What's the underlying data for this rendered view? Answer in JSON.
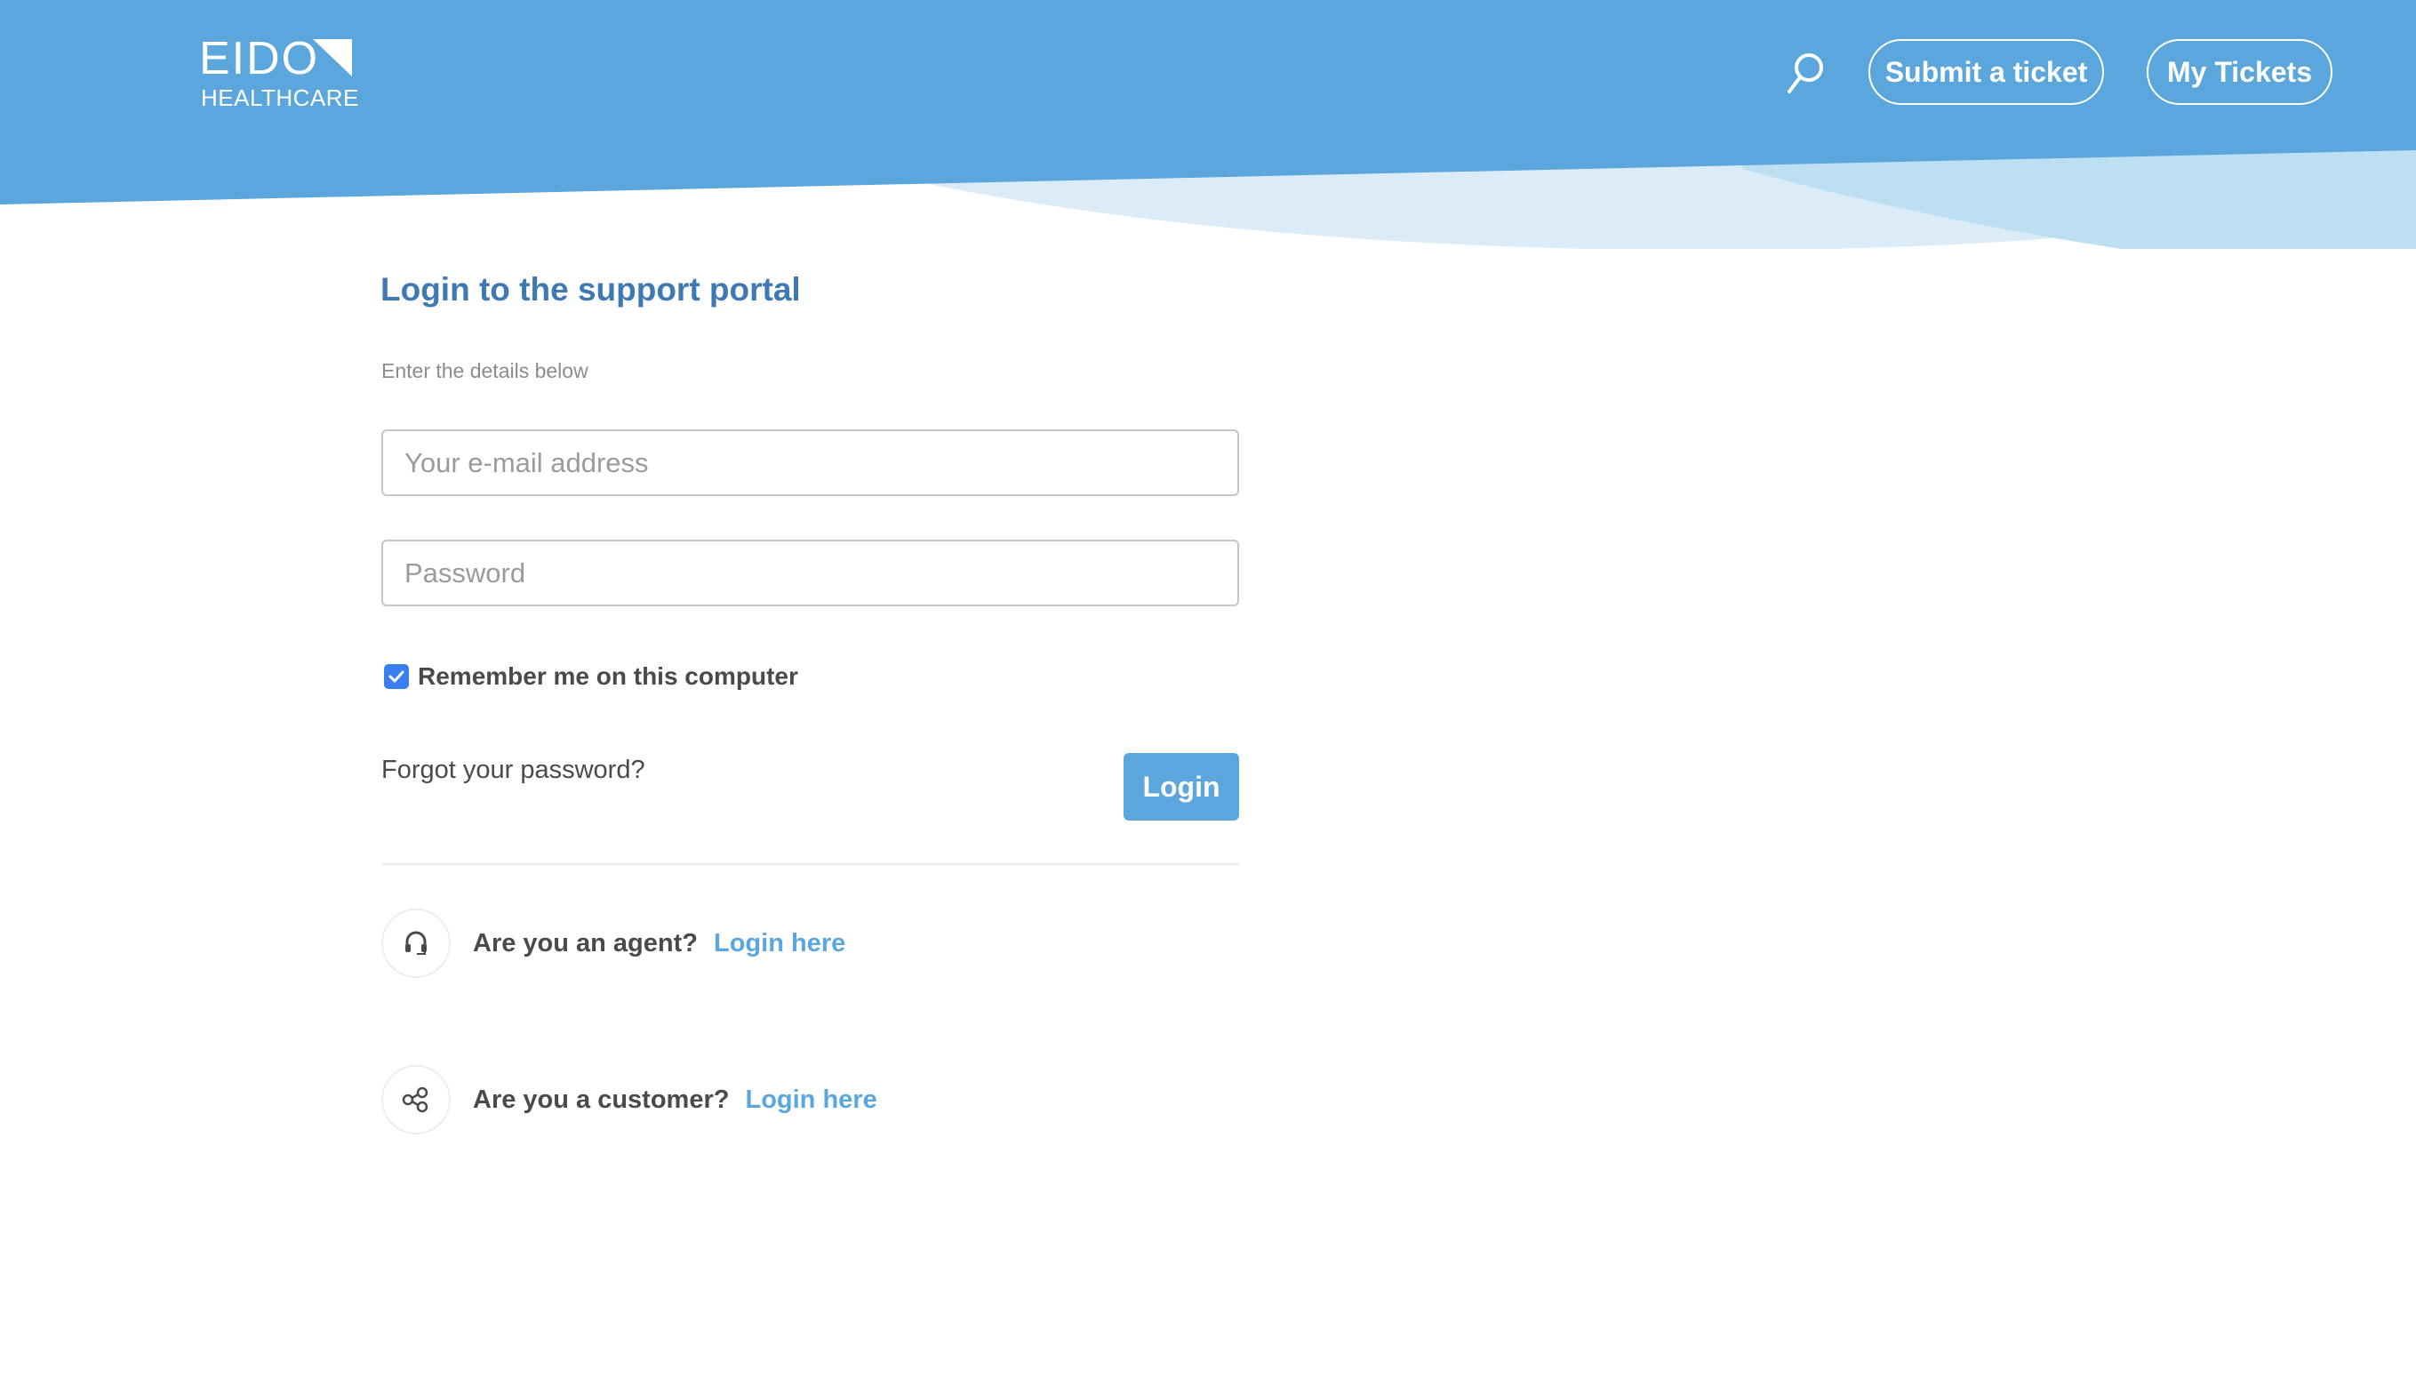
{
  "brand": {
    "logo_word": "EIDO",
    "logo_sub": "HEALTHCARE",
    "primary_color": "#5ba7dd",
    "heading_color": "#3f79b3",
    "checkbox_color": "#3a7ff0"
  },
  "header": {
    "search_icon": "search-icon",
    "submit_ticket_label": "Submit a ticket",
    "my_tickets_label": "My Tickets"
  },
  "login": {
    "title": "Login to the support portal",
    "subtitle": "Enter the details below",
    "email": {
      "value": "",
      "placeholder": "Your e-mail address"
    },
    "password": {
      "value": "",
      "placeholder": "Password"
    },
    "remember_label": "Remember me on this computer",
    "remember_checked": true,
    "forgot_label": "Forgot your password?",
    "submit_label": "Login"
  },
  "alternatives": [
    {
      "icon": "headset-icon",
      "question": "Are you an agent?",
      "link": "Login here"
    },
    {
      "icon": "share-nodes-icon",
      "question": "Are you a customer?",
      "link": "Login here"
    }
  ]
}
